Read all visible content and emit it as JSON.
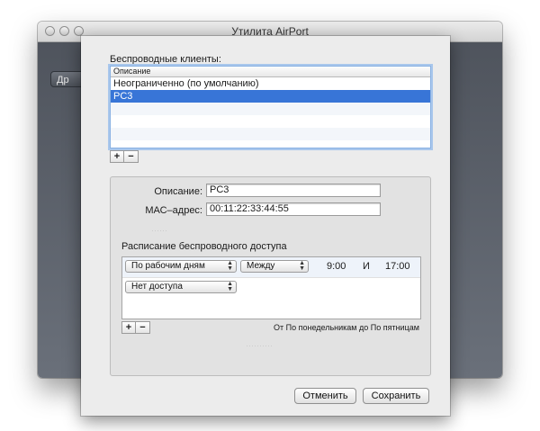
{
  "window": {
    "title": "Утилита AirPort",
    "background_button": "Др"
  },
  "sheet": {
    "clients_label": "Беспроводные клиенты:",
    "list": {
      "header": "Описание",
      "rows": [
        "Неограниченно (по умолчанию)",
        "PC3"
      ],
      "selected_index": 1
    },
    "add_label": "+",
    "remove_label": "−",
    "description_label": "Описание:",
    "description_value": "PC3",
    "mac_label": "МАС–адрес:",
    "mac_value": "00:11:22:33:44:55",
    "schedule_title": "Расписание беспроводного доступа",
    "schedule_rows": [
      {
        "days": "По рабочим дням",
        "mode": "Между",
        "from": "9:00",
        "and": "И",
        "to": "17:00"
      },
      {
        "days": "Нет доступа"
      }
    ],
    "schedule_add": "+",
    "schedule_remove": "−",
    "schedule_summary": "От По понедельникам до По пятницам",
    "cancel_button": "Отменить",
    "save_button": "Сохранить"
  },
  "colors": {
    "selection": "#3875d7",
    "focus_ring": "#a9c7ec"
  }
}
